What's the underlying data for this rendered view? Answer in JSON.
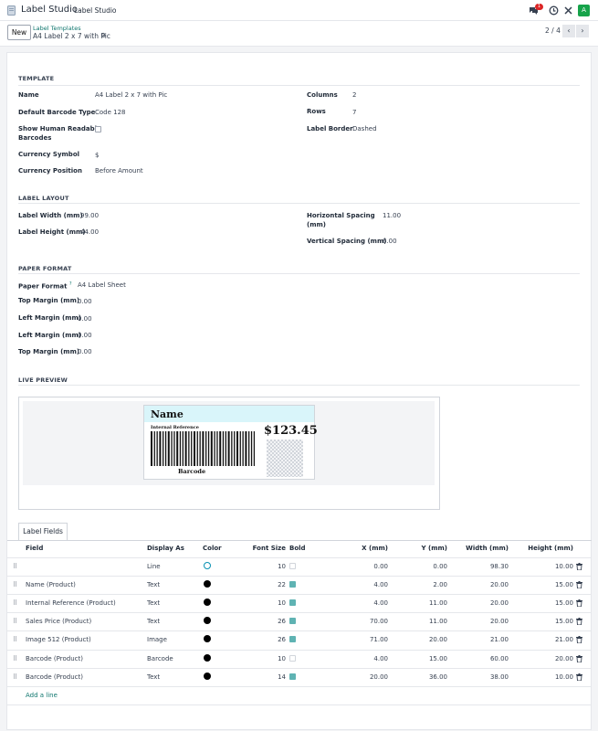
{
  "topbar": {
    "app_title": "Label Studio",
    "menu_item": "Label Studio",
    "message_count": "1",
    "avatar_letter": "A"
  },
  "control": {
    "new_label": "New",
    "breadcrumb_parent": "Label Templates",
    "breadcrumb_current": "A4 Label 2 x 7 with Pic",
    "pager": "2 / 4"
  },
  "template": {
    "section": "TEMPLATE",
    "name_label": "Name",
    "name_value": "A4 Label 2 x 7 with Pic",
    "barcode_type_label": "Default Barcode Type",
    "barcode_type_value": "Code 128",
    "show_human_label_1": "Show Human Readable",
    "show_human_label_2": "Barcodes",
    "currency_symbol_label": "Currency Symbol",
    "currency_symbol_value": "$",
    "currency_position_label": "Currency Position",
    "currency_position_value": "Before Amount",
    "columns_label": "Columns",
    "columns_value": "2",
    "rows_label": "Rows",
    "rows_value": "7",
    "border_label": "Label Border",
    "border_value": "Dashed"
  },
  "layout": {
    "section": "LABEL LAYOUT",
    "width_label": "Label Width (mm)",
    "width_value": "99.00",
    "height_label": "Label Height (mm)",
    "height_value": "44.00",
    "hspacing_label_1": "Horizontal Spacing",
    "hspacing_label_2": "(mm)",
    "hspacing_value": "11.00",
    "vspacing_label": "Vertical Spacing (mm)",
    "vspacing_value": "6.00"
  },
  "paper": {
    "section": "PAPER FORMAT",
    "format_label": "Paper Format",
    "format_help": "?",
    "format_value": "A4 Label Sheet",
    "top_margin_label": "Top Margin (mm)",
    "top_margin_value": "0.00",
    "left_margin_label": "Left Margin (mm)",
    "left_margin_value": "0.00",
    "left_margin2_label": "Left Margin (mm)",
    "left_margin2_value": "0.00",
    "top_margin2_label": "Top Margin (mm)",
    "top_margin2_value": "0.00"
  },
  "preview": {
    "section": "LIVE PREVIEW",
    "name": "Name",
    "reference": "Internal Reference",
    "price": "$123.45",
    "barcode": "Barcode"
  },
  "fields": {
    "tab": "Label Fields",
    "headers": {
      "field": "Field",
      "display": "Display As",
      "color": "Color",
      "font_size": "Font Size",
      "bold": "Bold",
      "x": "X (mm)",
      "y": "Y (mm)",
      "width": "Width (mm)",
      "height": "Height (mm)"
    },
    "rows": [
      {
        "field": "",
        "display": "Line",
        "color": "empty",
        "font_size": "10",
        "bold": false,
        "x": "0.00",
        "y": "0.00",
        "width": "98.30",
        "height": "10.00"
      },
      {
        "field": "Name (Product)",
        "display": "Text",
        "color": "#000000",
        "font_size": "22",
        "bold": true,
        "x": "4.00",
        "y": "2.00",
        "width": "20.00",
        "height": "15.00"
      },
      {
        "field": "Internal Reference (Product)",
        "display": "Text",
        "color": "#000000",
        "font_size": "10",
        "bold": true,
        "x": "4.00",
        "y": "11.00",
        "width": "20.00",
        "height": "15.00"
      },
      {
        "field": "Sales Price (Product)",
        "display": "Text",
        "color": "#000000",
        "font_size": "26",
        "bold": true,
        "x": "70.00",
        "y": "11.00",
        "width": "20.00",
        "height": "15.00"
      },
      {
        "field": "Image 512 (Product)",
        "display": "Image",
        "color": "#000000",
        "font_size": "26",
        "bold": true,
        "x": "71.00",
        "y": "20.00",
        "width": "21.00",
        "height": "21.00"
      },
      {
        "field": "Barcode (Product)",
        "display": "Barcode",
        "color": "#000000",
        "font_size": "10",
        "bold": false,
        "x": "4.00",
        "y": "15.00",
        "width": "60.00",
        "height": "20.00"
      },
      {
        "field": "Barcode (Product)",
        "display": "Text",
        "color": "#000000",
        "font_size": "14",
        "bold": true,
        "x": "20.00",
        "y": "36.00",
        "width": "38.00",
        "height": "10.00"
      }
    ],
    "add_line": "Add a line"
  }
}
